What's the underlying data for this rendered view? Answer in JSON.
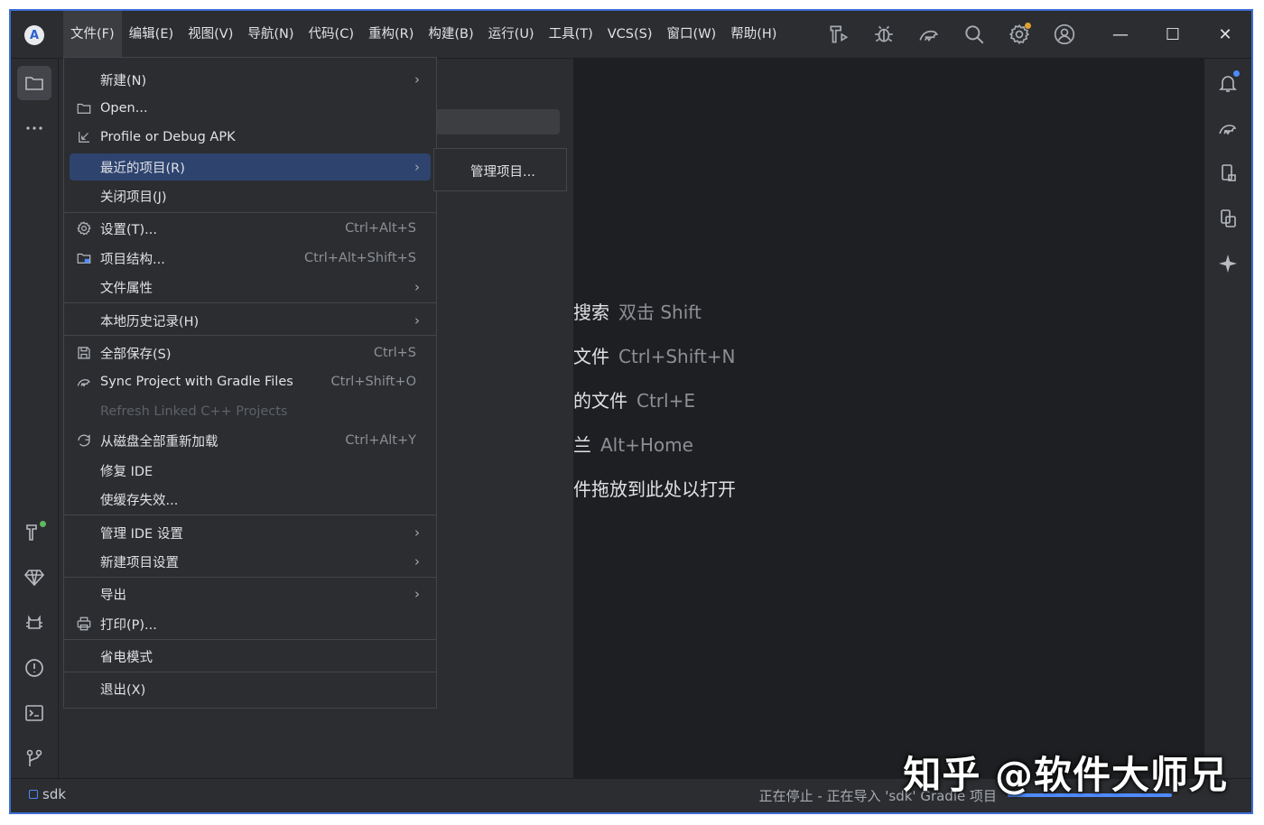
{
  "app": {
    "logo_letter": "A"
  },
  "menubar": [
    {
      "label": "文件(F)",
      "active": true
    },
    {
      "label": "编辑(E)"
    },
    {
      "label": "视图(V)"
    },
    {
      "label": "导航(N)"
    },
    {
      "label": "代码(C)"
    },
    {
      "label": "重构(R)"
    },
    {
      "label": "构建(B)"
    },
    {
      "label": "运行(U)"
    },
    {
      "label": "工具(T)"
    },
    {
      "label": "VCS(S)"
    },
    {
      "label": "窗口(W)"
    },
    {
      "label": "帮助(H)"
    }
  ],
  "toolbar_icons": [
    "build-icon",
    "debug-icon",
    "gradle-sync-icon",
    "search-icon",
    "settings-icon",
    "account-icon"
  ],
  "window_controls": {
    "minimize": "—",
    "maximize": "☐",
    "close": "✕"
  },
  "file_menu": {
    "items": [
      {
        "label": "新建(N)",
        "submenu": true
      },
      {
        "label": "Open...",
        "icon": "folder-icon"
      },
      {
        "label": "Profile or Debug APK",
        "icon": "profile-apk-icon"
      },
      {
        "label": "最近的项目(R)",
        "submenu": true,
        "highlighted": true
      },
      {
        "label": "关闭项目(J)"
      },
      {
        "label": "设置(T)...",
        "icon": "gear-icon",
        "shortcut": "Ctrl+Alt+S"
      },
      {
        "label": "项目结构...",
        "icon": "project-structure-icon",
        "shortcut": "Ctrl+Alt+Shift+S"
      },
      {
        "label": "文件属性",
        "submenu": true
      },
      {
        "label": "本地历史记录(H)",
        "submenu": true
      },
      {
        "label": "全部保存(S)",
        "icon": "save-icon",
        "shortcut": "Ctrl+S"
      },
      {
        "label": "Sync Project with Gradle Files",
        "icon": "gradle-sync-icon",
        "shortcut": "Ctrl+Shift+O"
      },
      {
        "label": "Refresh Linked C++ Projects",
        "disabled": true
      },
      {
        "label": "从磁盘全部重新加载",
        "icon": "reload-icon",
        "shortcut": "Ctrl+Alt+Y"
      },
      {
        "label": "修复 IDE"
      },
      {
        "label": "使缓存失效..."
      },
      {
        "label": "管理 IDE 设置",
        "submenu": true
      },
      {
        "label": "新建项目设置",
        "submenu": true
      },
      {
        "label": "导出",
        "submenu": true
      },
      {
        "label": "打印(P)...",
        "icon": "print-icon"
      },
      {
        "label": "省电模式"
      },
      {
        "label": "退出(X)"
      }
    ],
    "submenu_arrow": "›"
  },
  "recent_submenu": {
    "item": "管理项目..."
  },
  "hints": [
    {
      "label": "搜索",
      "key": "双击 Shift"
    },
    {
      "label": "文件",
      "key": "Ctrl+Shift+N"
    },
    {
      "label": "的文件",
      "key": "Ctrl+E"
    },
    {
      "label": "兰",
      "key": "Alt+Home"
    },
    {
      "label": "件拖放到此处以打开",
      "key": ""
    }
  ],
  "statusbar": {
    "project": "sdk",
    "task": "正在停止 - 正在导入 'sdk' Gradle 项目"
  },
  "watermark": "知乎 @软件大师兄",
  "colors": {
    "accent": "#3d6fd6",
    "highlight": "#2e436e",
    "background": "#1e1f22",
    "panel": "#2b2d30"
  }
}
